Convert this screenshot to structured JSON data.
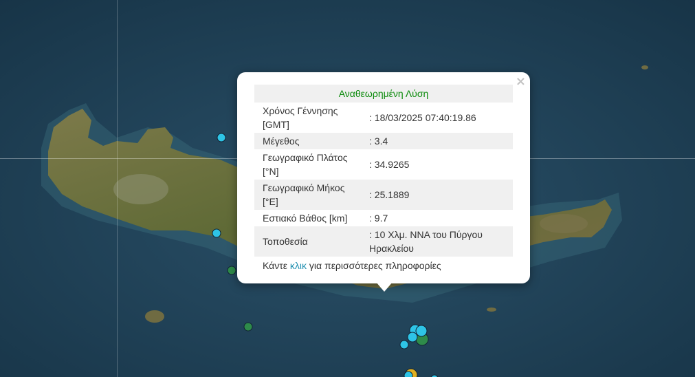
{
  "popup": {
    "title": "Αναθεωρημένη Λύση",
    "close_symbol": "×",
    "rows": [
      {
        "label": "Χρόνος Γέννησης [GMT]",
        "value": ": 18/03/2025 07:40:19.86"
      },
      {
        "label": "Μέγεθος",
        "value": ": 3.4"
      },
      {
        "label": "Γεωγραφικό Πλάτος [°N]",
        "value": ": 34.9265"
      },
      {
        "label": "Γεωγραφικό Μήκος [°E]",
        "value": ": 25.1889"
      },
      {
        "label": "Εστιακό Βάθος [km]",
        "value": ": 9.7"
      },
      {
        "label": "Τοποθεσία",
        "value": ": 10 Χλμ. ΝΝΑ του Πύργου Ηρακλείου"
      }
    ],
    "footer_before": "Κάντε ",
    "footer_link": "κλικ",
    "footer_after": " για περισσότερες πληροφορίες"
  },
  "colors": {
    "sea": "#1f3f55",
    "land": "#6b6a3e",
    "title_green": "#0a8a0a",
    "link": "#1f8fb0",
    "marker_cyan": "#2ec4e6",
    "marker_green": "#2e8b4a",
    "marker_yellow": "#e0b020"
  }
}
